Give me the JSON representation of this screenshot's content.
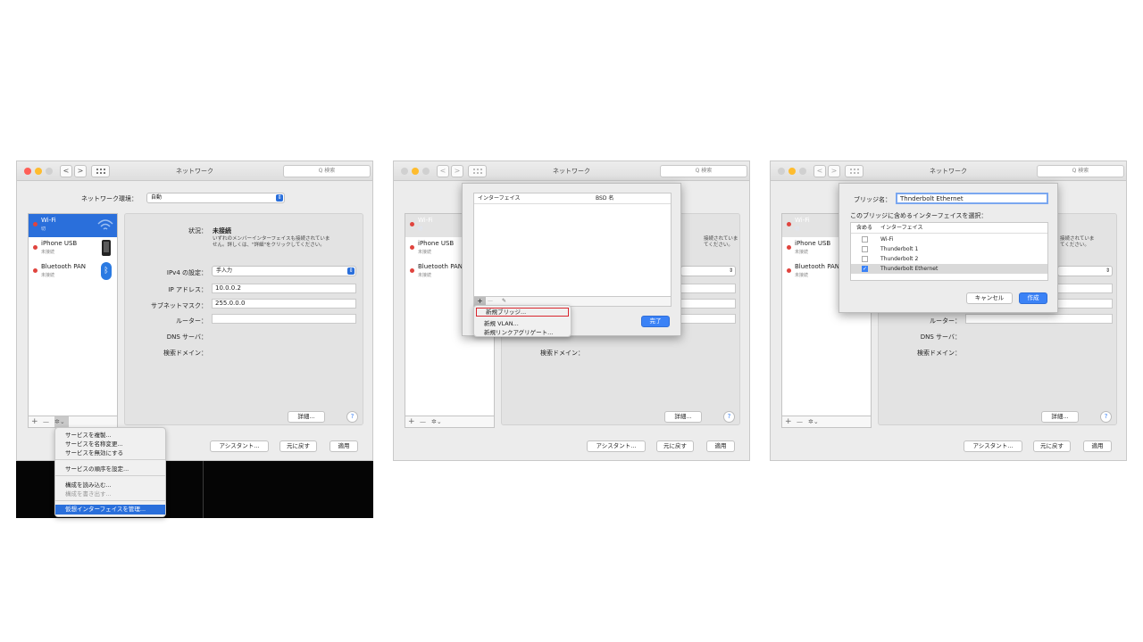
{
  "common": {
    "window_title": "ネットワーク",
    "search_placeholder": "Q 検索",
    "nav_back": "<",
    "nav_forward": ">"
  },
  "sidebar": {
    "services": [
      {
        "name": "Wi-Fi",
        "status": "切"
      },
      {
        "name": "iPhone USB",
        "status": "未接続"
      },
      {
        "name": "Bluetooth PAN",
        "status": "未接続"
      }
    ],
    "add": "+",
    "remove": "—",
    "gear": "✲⌄"
  },
  "panel1": {
    "location_label": "ネットワーク環境：",
    "location_value": "自動",
    "status_label": "状況：",
    "status_value": "未接続",
    "status_desc_1": "いずれのメンバーインターフェイスも接続されていま",
    "status_desc_2": "せん。詳しくは、\"詳細\"をクリックしてください。",
    "ipv4_label": "IPv4 の設定：",
    "ipv4_value": "手入力",
    "ip_label": "IP アドレス：",
    "ip_value": "10.0.0.2",
    "subnet_label": "サブネットマスク：",
    "subnet_value": "255.0.0.0",
    "router_label": "ルーター：",
    "dns_label": "DNS サーバ：",
    "search_domain_label": "検索ドメイン：",
    "advanced": "詳細...",
    "help": "?",
    "assistant": "アシスタント...",
    "revert": "元に戻す",
    "apply": "適用",
    "gear_menu": [
      {
        "label": "サービスを複製...",
        "state": "normal"
      },
      {
        "label": "サービスを名称変更...",
        "state": "normal"
      },
      {
        "label": "サービスを無効にする",
        "state": "normal"
      },
      {
        "label": "サービスの順序を設定...",
        "state": "normal"
      },
      {
        "label": "構成を読み込む...",
        "state": "normal"
      },
      {
        "label": "構成を書き出す...",
        "state": "disabled"
      },
      {
        "label": "仮想インターフェイスを管理...",
        "state": "highlighted"
      }
    ]
  },
  "panel2": {
    "col_interface": "インターフェイス",
    "col_bsd": "BSD 名",
    "toolbar_add": "+",
    "toolbar_remove": "—",
    "toolbar_edit": "✎",
    "done": "完了",
    "add_menu": [
      {
        "label": "新規ブリッジ...",
        "state": "selected"
      },
      {
        "label": "新規 VLAN...",
        "state": "normal"
      },
      {
        "label": "新規リンクアグリゲート...",
        "state": "normal"
      }
    ],
    "status_desc_1": "接続されていま",
    "status_desc_2": "てください。",
    "search_domain_label": "検索ドメイン：",
    "advanced": "詳細...",
    "help": "?",
    "assistant": "アシスタント...",
    "revert": "元に戻す",
    "apply": "適用"
  },
  "panel3": {
    "bridge_name_label": "ブリッジ名：",
    "bridge_name_value": "Thnderbolt Ethernet",
    "select_label": "このブリッジに含めるインターフェイスを選択：",
    "col_include": "含める",
    "col_interface": "インターフェイス",
    "interfaces": [
      {
        "name": "Wi-Fi",
        "checked": false
      },
      {
        "name": "Thunderbolt 1",
        "checked": false
      },
      {
        "name": "Thunderbolt 2",
        "checked": false
      },
      {
        "name": "Thunderbolt Ethernet",
        "checked": true
      }
    ],
    "check_mark": "✓",
    "cancel": "キャンセル",
    "create": "作成",
    "status_desc_1": "接続されていま",
    "status_desc_2": "てください。",
    "router_label": "ルーター：",
    "dns_label": "DNS サーバ：",
    "search_domain_label": "検索ドメイン：",
    "advanced": "詳細...",
    "help": "?",
    "assistant": "アシスタント...",
    "revert": "元に戻す",
    "apply": "適用"
  },
  "colors": {
    "accent": "#2a6fdb",
    "close": "#ff5f57",
    "minimize": "#febc2e",
    "status_red": "#e0443e"
  }
}
